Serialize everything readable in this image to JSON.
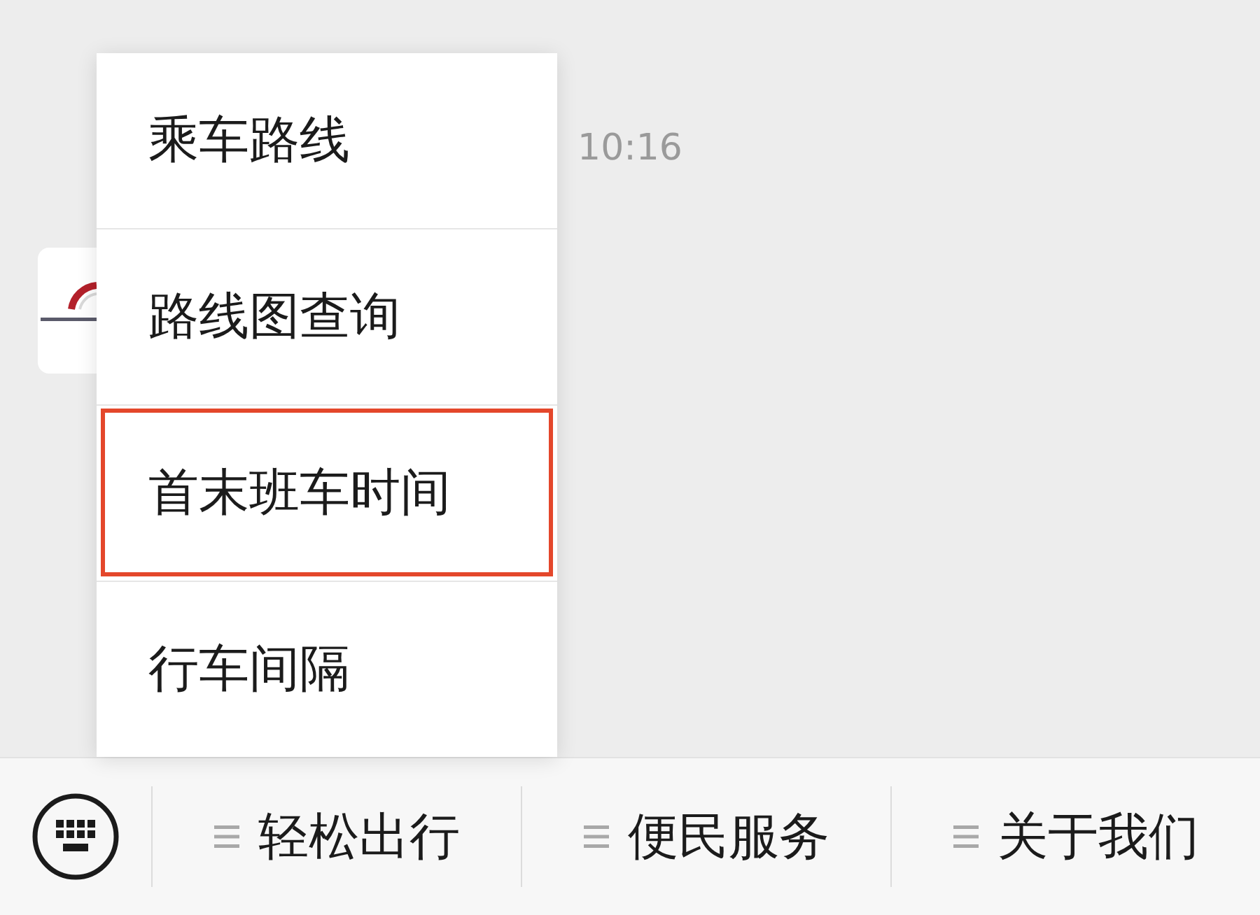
{
  "chat": {
    "timestamp": "10:16"
  },
  "popup_menu": {
    "items": [
      {
        "label": "乘车路线",
        "selected": false
      },
      {
        "label": "路线图查询",
        "selected": false
      },
      {
        "label": "首末班车时间",
        "selected": true
      },
      {
        "label": "行车间隔",
        "selected": false
      }
    ]
  },
  "bottom_bar": {
    "tabs": [
      {
        "label": "轻松出行"
      },
      {
        "label": "便民服务"
      },
      {
        "label": "关于我们"
      }
    ]
  }
}
